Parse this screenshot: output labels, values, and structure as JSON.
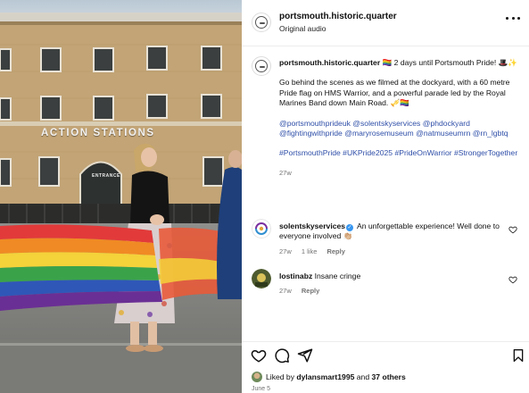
{
  "photo": {
    "sign_text": "ACTION STATIONS",
    "entrance_text": "ENTRANCE"
  },
  "post": {
    "username": "portsmouth.historic.quarter",
    "subline": "Original audio"
  },
  "caption": {
    "username": "portsmouth.historic.quarter",
    "headline": "🏳️‍🌈 2 days until Portsmouth Pride! 🎩✨",
    "body": "Go behind the scenes as we filmed at the dockyard, with a 60 metre Pride flag on HMS Warrior, and a powerful parade led by the Royal Marines Band down Main Road. 🎺🏳️‍🌈",
    "mentions": "@portsmouthprideuk @solentskyservices @phdockyard @fightingwithpride @maryrosemuseum @natmuseumrn @rn_lgbtq",
    "hashtags": "#PortsmouthPride #UKPride2025 #PrideOnWarrior #StrongerTogether",
    "time": "27w"
  },
  "comments": [
    {
      "username": "solentskyservices",
      "verified": true,
      "text": "An unforgettable experience! Well done to everyone involved 👏🏼",
      "time": "27w",
      "likes": "1 like",
      "reply": "Reply"
    },
    {
      "username": "lostinabz",
      "verified": false,
      "text": "Insane cringe",
      "time": "27w",
      "reply": "Reply"
    }
  ],
  "likes": {
    "prefix": "Liked by",
    "user": "dylansmart1995",
    "joiner": "and",
    "others": "37 others"
  },
  "date": "June 5",
  "colors": {
    "link": "#2f4fa8",
    "muted": "#737373",
    "verified": "#3897f0"
  },
  "icons": [
    "more-icon",
    "heart-icon",
    "comment-icon",
    "share-icon",
    "bookmark-icon"
  ]
}
